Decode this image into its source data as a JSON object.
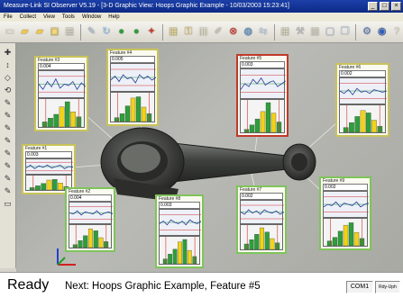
{
  "window": {
    "title": "Measure-Link SI Observer V5.19 - [3-D Graphic View: Hoops Graphic Example - 10/03/2003 15:23:41]",
    "controls": [
      "_",
      "□",
      "×"
    ]
  },
  "menu": [
    "File",
    "Collect",
    "View",
    "Tools",
    "Window",
    "Help"
  ],
  "toolbar": {
    "buttons": [
      {
        "icon": "new-document-icon",
        "glyph": "▭",
        "color": "#f6f1d8"
      },
      {
        "icon": "open-folder-icon",
        "glyph": "▰",
        "color": "#f0c64a"
      },
      {
        "icon": "folder-icon",
        "glyph": "▰",
        "color": "#f0c64a"
      },
      {
        "icon": "save-icon",
        "glyph": "▣",
        "color": "#f5d870"
      },
      {
        "icon": "print-icon",
        "glyph": "▤",
        "color": "#e8e4cf"
      },
      {
        "icon": "measure-icon",
        "glyph": "✎",
        "color": "#c8d8f0"
      },
      {
        "icon": "refresh-icon",
        "glyph": "↻",
        "color": "#9fd0ff"
      },
      {
        "icon": "go-green-icon",
        "glyph": "●",
        "color": "#2e9e3a"
      },
      {
        "icon": "go-green-2-icon",
        "glyph": "●",
        "color": "#2e9e3a"
      },
      {
        "icon": "probe-icon",
        "glyph": "✦",
        "color": "#d04030"
      },
      {
        "icon": "chart-icon",
        "glyph": "▦",
        "color": "#f0e0a0"
      },
      {
        "icon": "lock-icon",
        "glyph": "⚿",
        "color": "#f0d070"
      },
      {
        "icon": "report-icon",
        "glyph": "▥",
        "color": "#f6f1d8"
      },
      {
        "icon": "edit-icon",
        "glyph": "✐",
        "color": "#e8e4cf"
      },
      {
        "icon": "stop-icon",
        "glyph": "⊗",
        "color": "#e03a30"
      },
      {
        "icon": "globe-icon",
        "glyph": "◍",
        "color": "#5a9ad8"
      },
      {
        "icon": "arrow-icon",
        "glyph": "⇆",
        "color": "#c8d8f0"
      },
      {
        "icon": "grid-icon",
        "glyph": "▦",
        "color": "#e8e4cf"
      },
      {
        "icon": "wrench-icon",
        "glyph": "⚒",
        "color": "#c0c0c0"
      },
      {
        "icon": "image-icon",
        "glyph": "▨",
        "color": "#e8e4cf"
      },
      {
        "icon": "window-icon",
        "glyph": "▢",
        "color": "#c8d8f0"
      },
      {
        "icon": "cascade-icon",
        "glyph": "❐",
        "color": "#c8d8f0"
      },
      {
        "icon": "settings-icon",
        "glyph": "⚙",
        "color": "#6a8ac8"
      },
      {
        "icon": "color-icon",
        "glyph": "◉",
        "color": "#3060c0"
      },
      {
        "icon": "help-icon",
        "glyph": "?",
        "color": "#e8e4cf"
      }
    ]
  },
  "sidetools": [
    "✚",
    "↕",
    "◇",
    "⟲",
    "✎",
    "✎",
    "✎",
    "✎",
    "✎",
    "✎",
    "✎",
    "✎",
    "▭"
  ],
  "features": [
    {
      "title": "Feature #3",
      "value": "0.004",
      "state": "normal",
      "run": [
        0.5,
        0.3,
        0.6,
        0.4,
        0.7,
        0.35,
        0.5,
        0.45,
        0.6,
        0.3,
        0.55,
        0.4
      ],
      "hist": [
        0.2,
        0.35,
        0.5,
        0.8,
        1.0,
        0.6,
        0.4
      ]
    },
    {
      "title": "Feature #4",
      "value": "0.005",
      "state": "normal",
      "run": [
        0.4,
        0.55,
        0.35,
        0.6,
        0.45,
        0.5,
        0.3,
        0.6,
        0.45,
        0.55,
        0.4,
        0.5
      ],
      "hist": [
        0.15,
        0.3,
        0.6,
        0.9,
        0.95,
        0.55,
        0.3
      ]
    },
    {
      "title": "Feature #5",
      "value": "0.003",
      "state": "active",
      "run": [
        0.3,
        0.5,
        0.4,
        0.65,
        0.5,
        0.7,
        0.45,
        0.55,
        0.6,
        0.4,
        0.5,
        0.6
      ],
      "hist": [
        0.1,
        0.25,
        0.45,
        0.7,
        1.0,
        0.65,
        0.35
      ]
    },
    {
      "title": "Feature #6",
      "value": "0.002",
      "state": "normal",
      "run": [
        0.5,
        0.4,
        0.55,
        0.35,
        0.6,
        0.45,
        0.5,
        0.4,
        0.55,
        0.5,
        0.45,
        0.5
      ],
      "hist": [
        0.2,
        0.4,
        0.65,
        0.9,
        0.8,
        0.5,
        0.25
      ]
    },
    {
      "title": "Feature #1",
      "value": "0.003",
      "state": "normal",
      "run": [
        0.4,
        0.6,
        0.35,
        0.55,
        0.45,
        0.6,
        0.4,
        0.5,
        0.6,
        0.35,
        0.5,
        0.45
      ],
      "hist": [
        0.2,
        0.35,
        0.55,
        0.85,
        0.9,
        0.6,
        0.3
      ]
    },
    {
      "title": "Feature #2",
      "value": "0.004",
      "state": "green",
      "run": [
        0.5,
        0.45,
        0.6,
        0.4,
        0.55,
        0.5,
        0.45,
        0.6,
        0.4,
        0.5,
        0.55,
        0.45
      ],
      "hist": [
        0.15,
        0.35,
        0.6,
        0.95,
        0.85,
        0.5,
        0.3
      ]
    },
    {
      "title": "Feature #8",
      "value": "0.003",
      "state": "green",
      "run": [
        0.45,
        0.55,
        0.4,
        0.6,
        0.5,
        0.45,
        0.55,
        0.4,
        0.6,
        0.5,
        0.45,
        0.55
      ],
      "hist": [
        0.2,
        0.4,
        0.6,
        0.9,
        1.0,
        0.55,
        0.3
      ]
    },
    {
      "title": "Feature #7",
      "value": "0.002",
      "state": "green",
      "run": [
        0.5,
        0.4,
        0.6,
        0.45,
        0.55,
        0.4,
        0.6,
        0.5,
        0.45,
        0.55,
        0.4,
        0.5
      ],
      "hist": [
        0.25,
        0.45,
        0.7,
        1.0,
        0.8,
        0.5,
        0.3
      ]
    },
    {
      "title": "Feature #9",
      "value": "0.002",
      "state": "green",
      "run": [
        0.4,
        0.5,
        0.45,
        0.6,
        0.4,
        0.55,
        0.5,
        0.45,
        0.6,
        0.4,
        0.5,
        0.55
      ],
      "hist": [
        0.2,
        0.35,
        0.6,
        0.85,
        0.95,
        0.55,
        0.3
      ]
    }
  ],
  "status": {
    "main": "Ready",
    "next": "Next: Hoops Graphic Example, Feature #5",
    "port": "COM1",
    "extra": "Rdy-Uph"
  },
  "colors": {
    "titlebar": "#0c2a86",
    "feature_border": "#c9c35a",
    "active_border": "#c0392b",
    "green_border": "#7fc45a",
    "hist_bar": "#2e9e3a",
    "hist_bar_alt": "#f2d21a",
    "run_line": "#203a9a"
  }
}
